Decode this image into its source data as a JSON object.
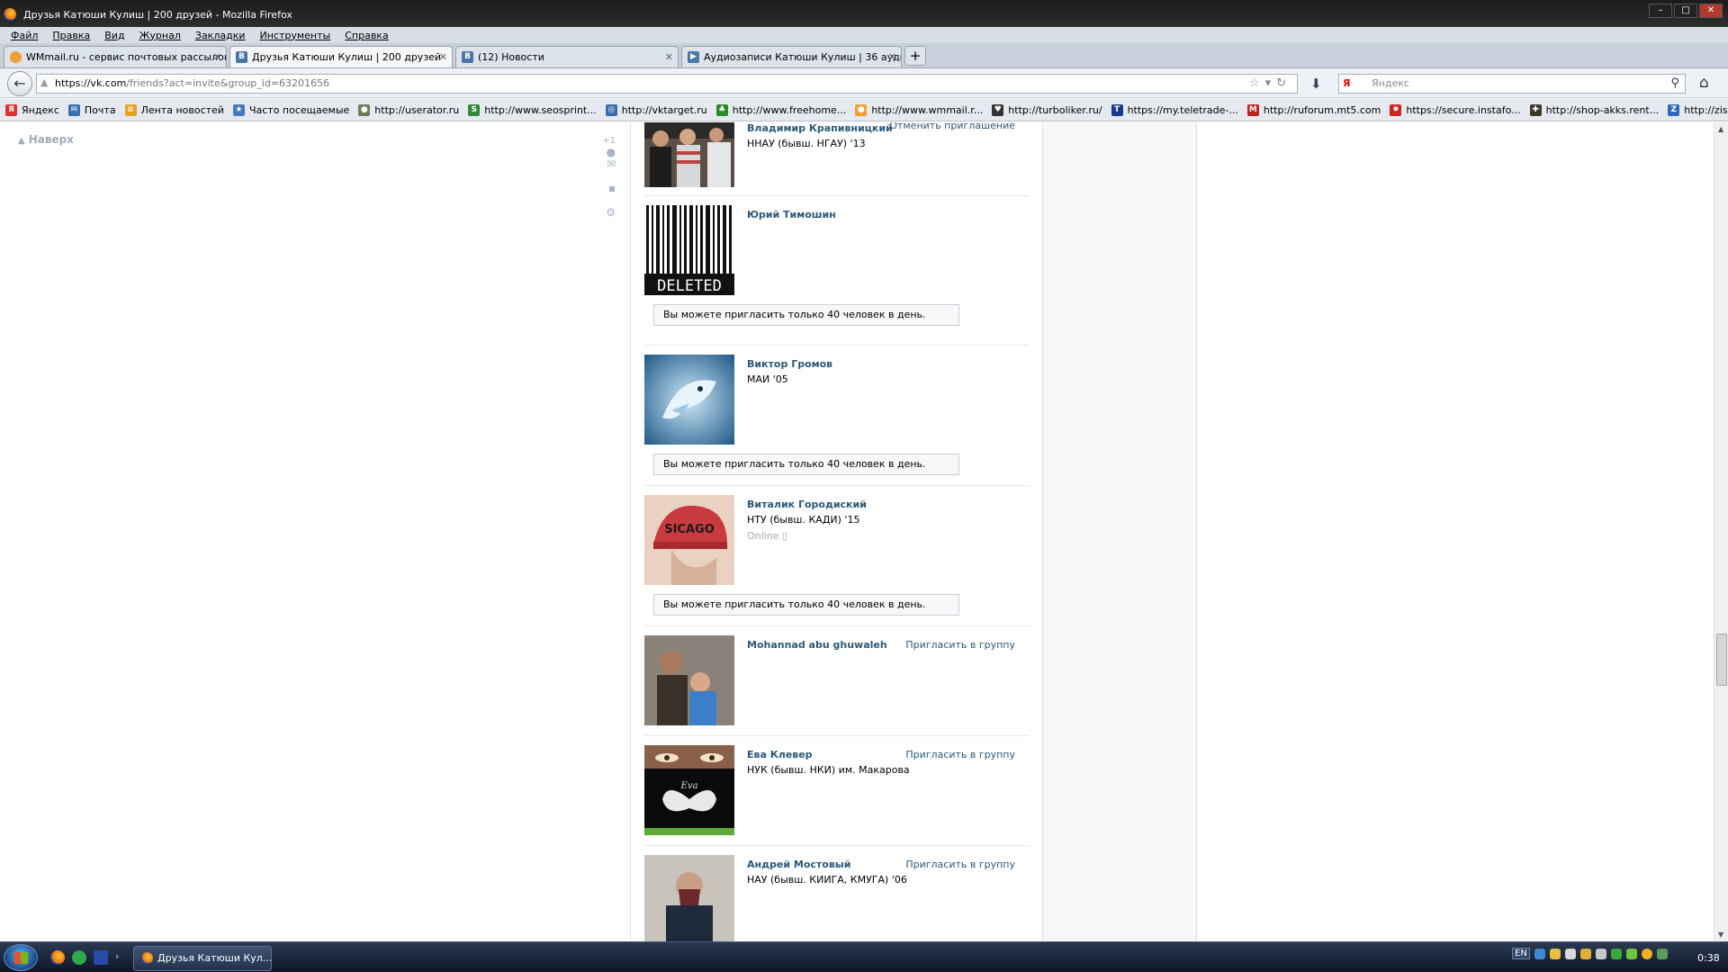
{
  "window": {
    "title": "Друзья Катюши Кулиш | 200 друзей - Mozilla Firefox",
    "controls": [
      "–",
      "□",
      "✕"
    ]
  },
  "menu": [
    "Файл",
    "Правка",
    "Вид",
    "Журнал",
    "Закладки",
    "Инструменты",
    "Справка"
  ],
  "tabs": [
    {
      "label": "WMmail.ru - сервис почтовых рассылок...",
      "icon": "wmmail-icon",
      "color": "#f0a030"
    },
    {
      "label": "Друзья Катюши Кулиш | 200 друзей",
      "icon": "vk-icon",
      "color": "#4a76a8"
    },
    {
      "label": "(12) Новости",
      "icon": "vk-icon",
      "color": "#4a76a8"
    },
    {
      "label": "Аудиозаписи Катюши Кулиш | 36 ауди...",
      "icon": "play-icon",
      "color": "#4a76a8"
    }
  ],
  "newtab": "+",
  "address": {
    "host": "https://vk.com",
    "path": "/friends?act=invite&group_id=63201656"
  },
  "search": {
    "placeholder": "Яндекс",
    "engine": "Я"
  },
  "bookmarks": [
    {
      "label": "Яндекс",
      "color": "#e03030",
      "glyph": "Я"
    },
    {
      "label": "Почта",
      "color": "#3a6fb8",
      "glyph": "✉"
    },
    {
      "label": "Лента новостей",
      "color": "#e8a020",
      "glyph": "≡"
    },
    {
      "label": "Часто посещаемые",
      "color": "#4a78b8",
      "glyph": "★"
    },
    {
      "label": "http://userator.ru",
      "color": "#707a58",
      "glyph": "●"
    },
    {
      "label": "http://www.seosprint...",
      "color": "#2f8a3a",
      "glyph": "S"
    },
    {
      "label": "http://vktarget.ru",
      "color": "#3a6ab0",
      "glyph": "◎"
    },
    {
      "label": "http://www.freehome...",
      "color": "#2a8a2a",
      "glyph": "♣"
    },
    {
      "label": "http://www.wmmail.r...",
      "color": "#f0a030",
      "glyph": "●"
    },
    {
      "label": "http://turboliker.ru/",
      "color": "#333333",
      "glyph": "♥"
    },
    {
      "label": "https://my.teletrade-...",
      "color": "#1a3a8a",
      "glyph": "T"
    },
    {
      "label": "http://ruforum.mt5.com",
      "color": "#c02020",
      "glyph": "M"
    },
    {
      "label": "https://secure.instafo...",
      "color": "#d02020",
      "glyph": "✸"
    },
    {
      "label": "http://shop-akks.rent...",
      "color": "#3a3a2a",
      "glyph": "✚"
    },
    {
      "label": "http://zismo.biz/",
      "color": "#2a6ac0",
      "glyph": "Z"
    }
  ],
  "sidebar": {
    "top_link": "Наверх",
    "plus_one": "+1"
  },
  "friends": [
    {
      "name": "Владимир Крапивницкий",
      "edu": "ННАУ (бывш. НГАУ) '13",
      "action": "Отменить приглашение",
      "limit": "",
      "online": ""
    },
    {
      "name": "Юрий Тимошин",
      "edu": "",
      "action": "",
      "limit": "Вы можете пригласить только 40 человек в день.",
      "online": "",
      "deleted_text": "DELETED"
    },
    {
      "name": "Виктор Громов",
      "edu": "МАИ '05",
      "action": "",
      "limit": "Вы можете пригласить только 40 человек в день.",
      "online": ""
    },
    {
      "name": "Виталик Городиский",
      "edu": "НТУ (бывш. КАДИ) '15",
      "action": "",
      "limit": "Вы можете пригласить только 40 человек в день.",
      "online": "Online",
      "cap_text": "SICAGO"
    },
    {
      "name": "Mohannad abu ghuwaleh",
      "edu": "",
      "action": "Пригласить в группу",
      "limit": "",
      "online": ""
    },
    {
      "name": "Ева Клевер",
      "edu": "НУК (бывш. НКИ) им. Макарова",
      "action": "Пригласить в группу",
      "limit": "",
      "online": "",
      "avatar_text": "Eva"
    },
    {
      "name": "Андрей Мостовый",
      "edu": "НАУ (бывш. КИИГА, КМУГА) '06",
      "action": "Пригласить в группу",
      "limit": "",
      "online": ""
    }
  ],
  "taskbar": {
    "active_window": "Друзья Катюши Кул...",
    "lang": "EN",
    "clock": "0:38"
  }
}
